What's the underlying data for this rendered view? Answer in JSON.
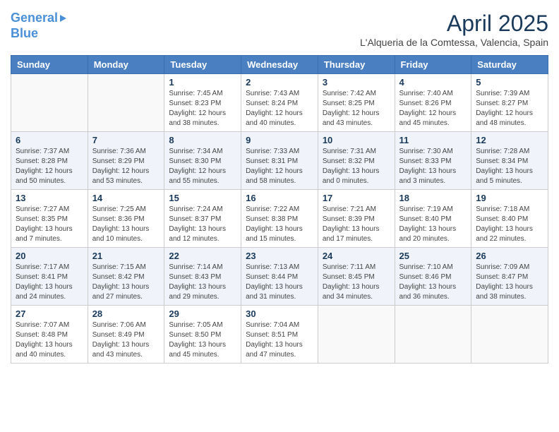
{
  "logo": {
    "line1": "General",
    "line2": "Blue"
  },
  "title": "April 2025",
  "location": "L'Alqueria de la Comtessa, Valencia, Spain",
  "days_of_week": [
    "Sunday",
    "Monday",
    "Tuesday",
    "Wednesday",
    "Thursday",
    "Friday",
    "Saturday"
  ],
  "weeks": [
    [
      {
        "num": "",
        "info": ""
      },
      {
        "num": "",
        "info": ""
      },
      {
        "num": "1",
        "info": "Sunrise: 7:45 AM\nSunset: 8:23 PM\nDaylight: 12 hours\nand 38 minutes."
      },
      {
        "num": "2",
        "info": "Sunrise: 7:43 AM\nSunset: 8:24 PM\nDaylight: 12 hours\nand 40 minutes."
      },
      {
        "num": "3",
        "info": "Sunrise: 7:42 AM\nSunset: 8:25 PM\nDaylight: 12 hours\nand 43 minutes."
      },
      {
        "num": "4",
        "info": "Sunrise: 7:40 AM\nSunset: 8:26 PM\nDaylight: 12 hours\nand 45 minutes."
      },
      {
        "num": "5",
        "info": "Sunrise: 7:39 AM\nSunset: 8:27 PM\nDaylight: 12 hours\nand 48 minutes."
      }
    ],
    [
      {
        "num": "6",
        "info": "Sunrise: 7:37 AM\nSunset: 8:28 PM\nDaylight: 12 hours\nand 50 minutes."
      },
      {
        "num": "7",
        "info": "Sunrise: 7:36 AM\nSunset: 8:29 PM\nDaylight: 12 hours\nand 53 minutes."
      },
      {
        "num": "8",
        "info": "Sunrise: 7:34 AM\nSunset: 8:30 PM\nDaylight: 12 hours\nand 55 minutes."
      },
      {
        "num": "9",
        "info": "Sunrise: 7:33 AM\nSunset: 8:31 PM\nDaylight: 12 hours\nand 58 minutes."
      },
      {
        "num": "10",
        "info": "Sunrise: 7:31 AM\nSunset: 8:32 PM\nDaylight: 13 hours\nand 0 minutes."
      },
      {
        "num": "11",
        "info": "Sunrise: 7:30 AM\nSunset: 8:33 PM\nDaylight: 13 hours\nand 3 minutes."
      },
      {
        "num": "12",
        "info": "Sunrise: 7:28 AM\nSunset: 8:34 PM\nDaylight: 13 hours\nand 5 minutes."
      }
    ],
    [
      {
        "num": "13",
        "info": "Sunrise: 7:27 AM\nSunset: 8:35 PM\nDaylight: 13 hours\nand 7 minutes."
      },
      {
        "num": "14",
        "info": "Sunrise: 7:25 AM\nSunset: 8:36 PM\nDaylight: 13 hours\nand 10 minutes."
      },
      {
        "num": "15",
        "info": "Sunrise: 7:24 AM\nSunset: 8:37 PM\nDaylight: 13 hours\nand 12 minutes."
      },
      {
        "num": "16",
        "info": "Sunrise: 7:22 AM\nSunset: 8:38 PM\nDaylight: 13 hours\nand 15 minutes."
      },
      {
        "num": "17",
        "info": "Sunrise: 7:21 AM\nSunset: 8:39 PM\nDaylight: 13 hours\nand 17 minutes."
      },
      {
        "num": "18",
        "info": "Sunrise: 7:19 AM\nSunset: 8:40 PM\nDaylight: 13 hours\nand 20 minutes."
      },
      {
        "num": "19",
        "info": "Sunrise: 7:18 AM\nSunset: 8:40 PM\nDaylight: 13 hours\nand 22 minutes."
      }
    ],
    [
      {
        "num": "20",
        "info": "Sunrise: 7:17 AM\nSunset: 8:41 PM\nDaylight: 13 hours\nand 24 minutes."
      },
      {
        "num": "21",
        "info": "Sunrise: 7:15 AM\nSunset: 8:42 PM\nDaylight: 13 hours\nand 27 minutes."
      },
      {
        "num": "22",
        "info": "Sunrise: 7:14 AM\nSunset: 8:43 PM\nDaylight: 13 hours\nand 29 minutes."
      },
      {
        "num": "23",
        "info": "Sunrise: 7:13 AM\nSunset: 8:44 PM\nDaylight: 13 hours\nand 31 minutes."
      },
      {
        "num": "24",
        "info": "Sunrise: 7:11 AM\nSunset: 8:45 PM\nDaylight: 13 hours\nand 34 minutes."
      },
      {
        "num": "25",
        "info": "Sunrise: 7:10 AM\nSunset: 8:46 PM\nDaylight: 13 hours\nand 36 minutes."
      },
      {
        "num": "26",
        "info": "Sunrise: 7:09 AM\nSunset: 8:47 PM\nDaylight: 13 hours\nand 38 minutes."
      }
    ],
    [
      {
        "num": "27",
        "info": "Sunrise: 7:07 AM\nSunset: 8:48 PM\nDaylight: 13 hours\nand 40 minutes."
      },
      {
        "num": "28",
        "info": "Sunrise: 7:06 AM\nSunset: 8:49 PM\nDaylight: 13 hours\nand 43 minutes."
      },
      {
        "num": "29",
        "info": "Sunrise: 7:05 AM\nSunset: 8:50 PM\nDaylight: 13 hours\nand 45 minutes."
      },
      {
        "num": "30",
        "info": "Sunrise: 7:04 AM\nSunset: 8:51 PM\nDaylight: 13 hours\nand 47 minutes."
      },
      {
        "num": "",
        "info": ""
      },
      {
        "num": "",
        "info": ""
      },
      {
        "num": "",
        "info": ""
      }
    ]
  ]
}
